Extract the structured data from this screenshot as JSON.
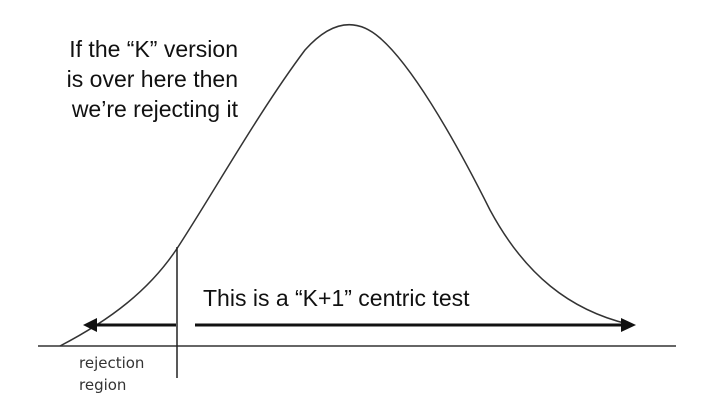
{
  "annotation": {
    "lines": [
      "If the “K” version",
      "is over here then",
      "we’re rejecting it"
    ]
  },
  "arrow_label": "This is a “K+1” centric test",
  "region_label": {
    "lines": [
      "rejection",
      "region"
    ]
  },
  "colors": {
    "curve": "#333333",
    "arrows": "#111111",
    "text": "#111111"
  }
}
